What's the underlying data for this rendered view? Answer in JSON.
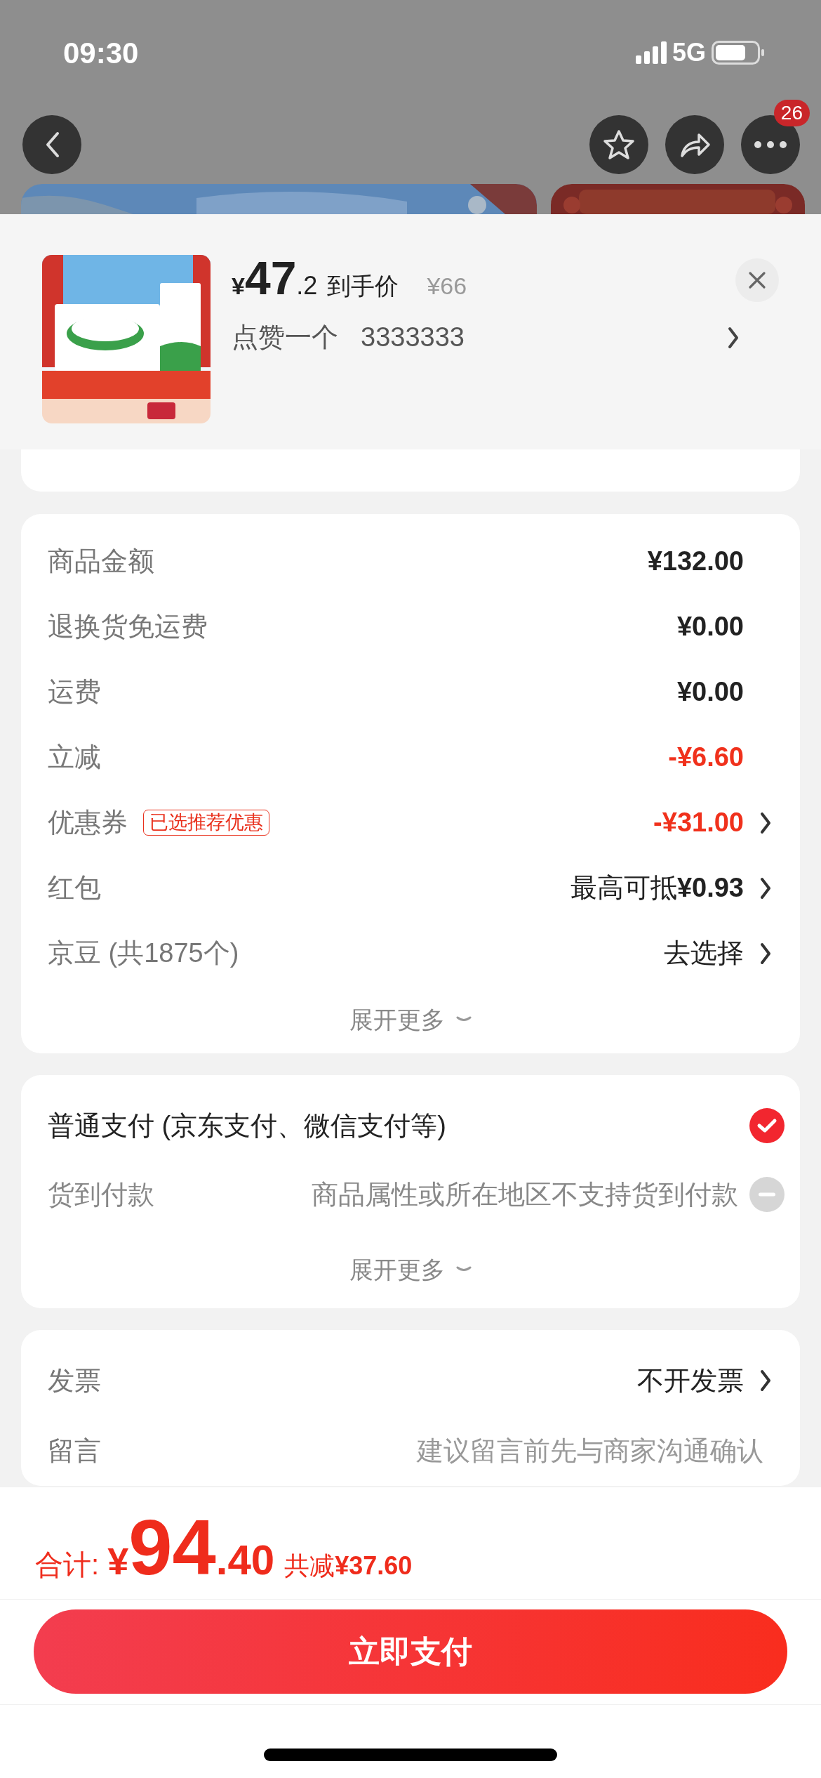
{
  "status_bar": {
    "time": "09:30",
    "network": "5G"
  },
  "nav": {
    "badge": "26"
  },
  "sheet": {
    "currency": "¥",
    "price_int": "47",
    "price_dec": ".2",
    "price_label": "到手价",
    "original_price": "¥66",
    "subtitle": "点赞一个",
    "value": "3333333"
  },
  "fees": [
    {
      "kind": "amount",
      "label": "商品金额",
      "value": "¥132.00",
      "arrow": false
    },
    {
      "kind": "amount",
      "label": "退换货免运费",
      "value": "¥0.00",
      "arrow": false
    },
    {
      "kind": "amount",
      "label": "运费",
      "value": "¥0.00",
      "arrow": false
    },
    {
      "kind": "discount",
      "label": "立减",
      "value": "-¥6.60",
      "arrow": false
    },
    {
      "kind": "discount",
      "label": "优惠券",
      "tag": "已选推荐优惠",
      "value": "-¥31.00",
      "arrow": true
    },
    {
      "kind": "option",
      "label": "红包",
      "value": "最高可抵**¥0.93**",
      "arrow": true
    },
    {
      "kind": "option",
      "label": "京豆 (共1875个)",
      "value": "去选择",
      "arrow": true
    }
  ],
  "fees_expand": "展开更多",
  "payment": {
    "options": [
      {
        "label": "普通支付 (京东支付、微信支付等)",
        "selected": true,
        "disabled": false
      },
      {
        "label": "货到付款",
        "note": "商品属性或所在地区不支持货到付款",
        "selected": false,
        "disabled": true
      }
    ],
    "expand": "展开更多"
  },
  "other": [
    {
      "kind": "value",
      "label": "发票",
      "value": "不开发票",
      "arrow": true
    },
    {
      "kind": "input",
      "label": "留言",
      "placeholder": "建议留言前先与商家沟通确认"
    }
  ],
  "footer": {
    "total_label": "合计:",
    "currency": "¥",
    "total_int": "94",
    "total_dec": ".40",
    "saved": "共减**¥37.60**",
    "pay_button": "立即支付"
  }
}
